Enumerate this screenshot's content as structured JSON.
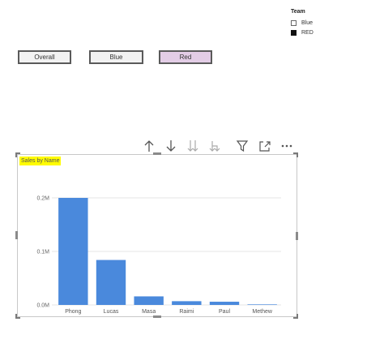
{
  "slicer": {
    "title": "Team",
    "items": [
      {
        "label": "Blue",
        "checked": false
      },
      {
        "label": "RED",
        "checked": true
      }
    ]
  },
  "buttons": {
    "overall": "Overall",
    "blue": "Blue",
    "red": "Red"
  },
  "toolbar": {
    "icons": [
      "arrow-up-icon",
      "arrow-down-icon",
      "double-arrow-down-icon",
      "expand-hierarchy-icon",
      "filter-icon",
      "focus-mode-icon",
      "more-options-icon"
    ]
  },
  "visual": {
    "title": "Sales by Name",
    "highlight_color": "#fffb00"
  },
  "chart_data": {
    "type": "bar",
    "categories": [
      "Phong",
      "Lucas",
      "Masa",
      "Raimi",
      "Paul",
      "Methew"
    ],
    "values": [
      0.2,
      0.084,
      0.016,
      0.007,
      0.006,
      0.001
    ],
    "ylim": [
      0,
      0.2
    ],
    "ytick_labels": [
      "0.0M",
      "0.1M",
      "0.2M"
    ],
    "ytick_values": [
      0,
      0.1,
      0.2
    ],
    "grid": true,
    "bar_color": "#4a89dc"
  }
}
